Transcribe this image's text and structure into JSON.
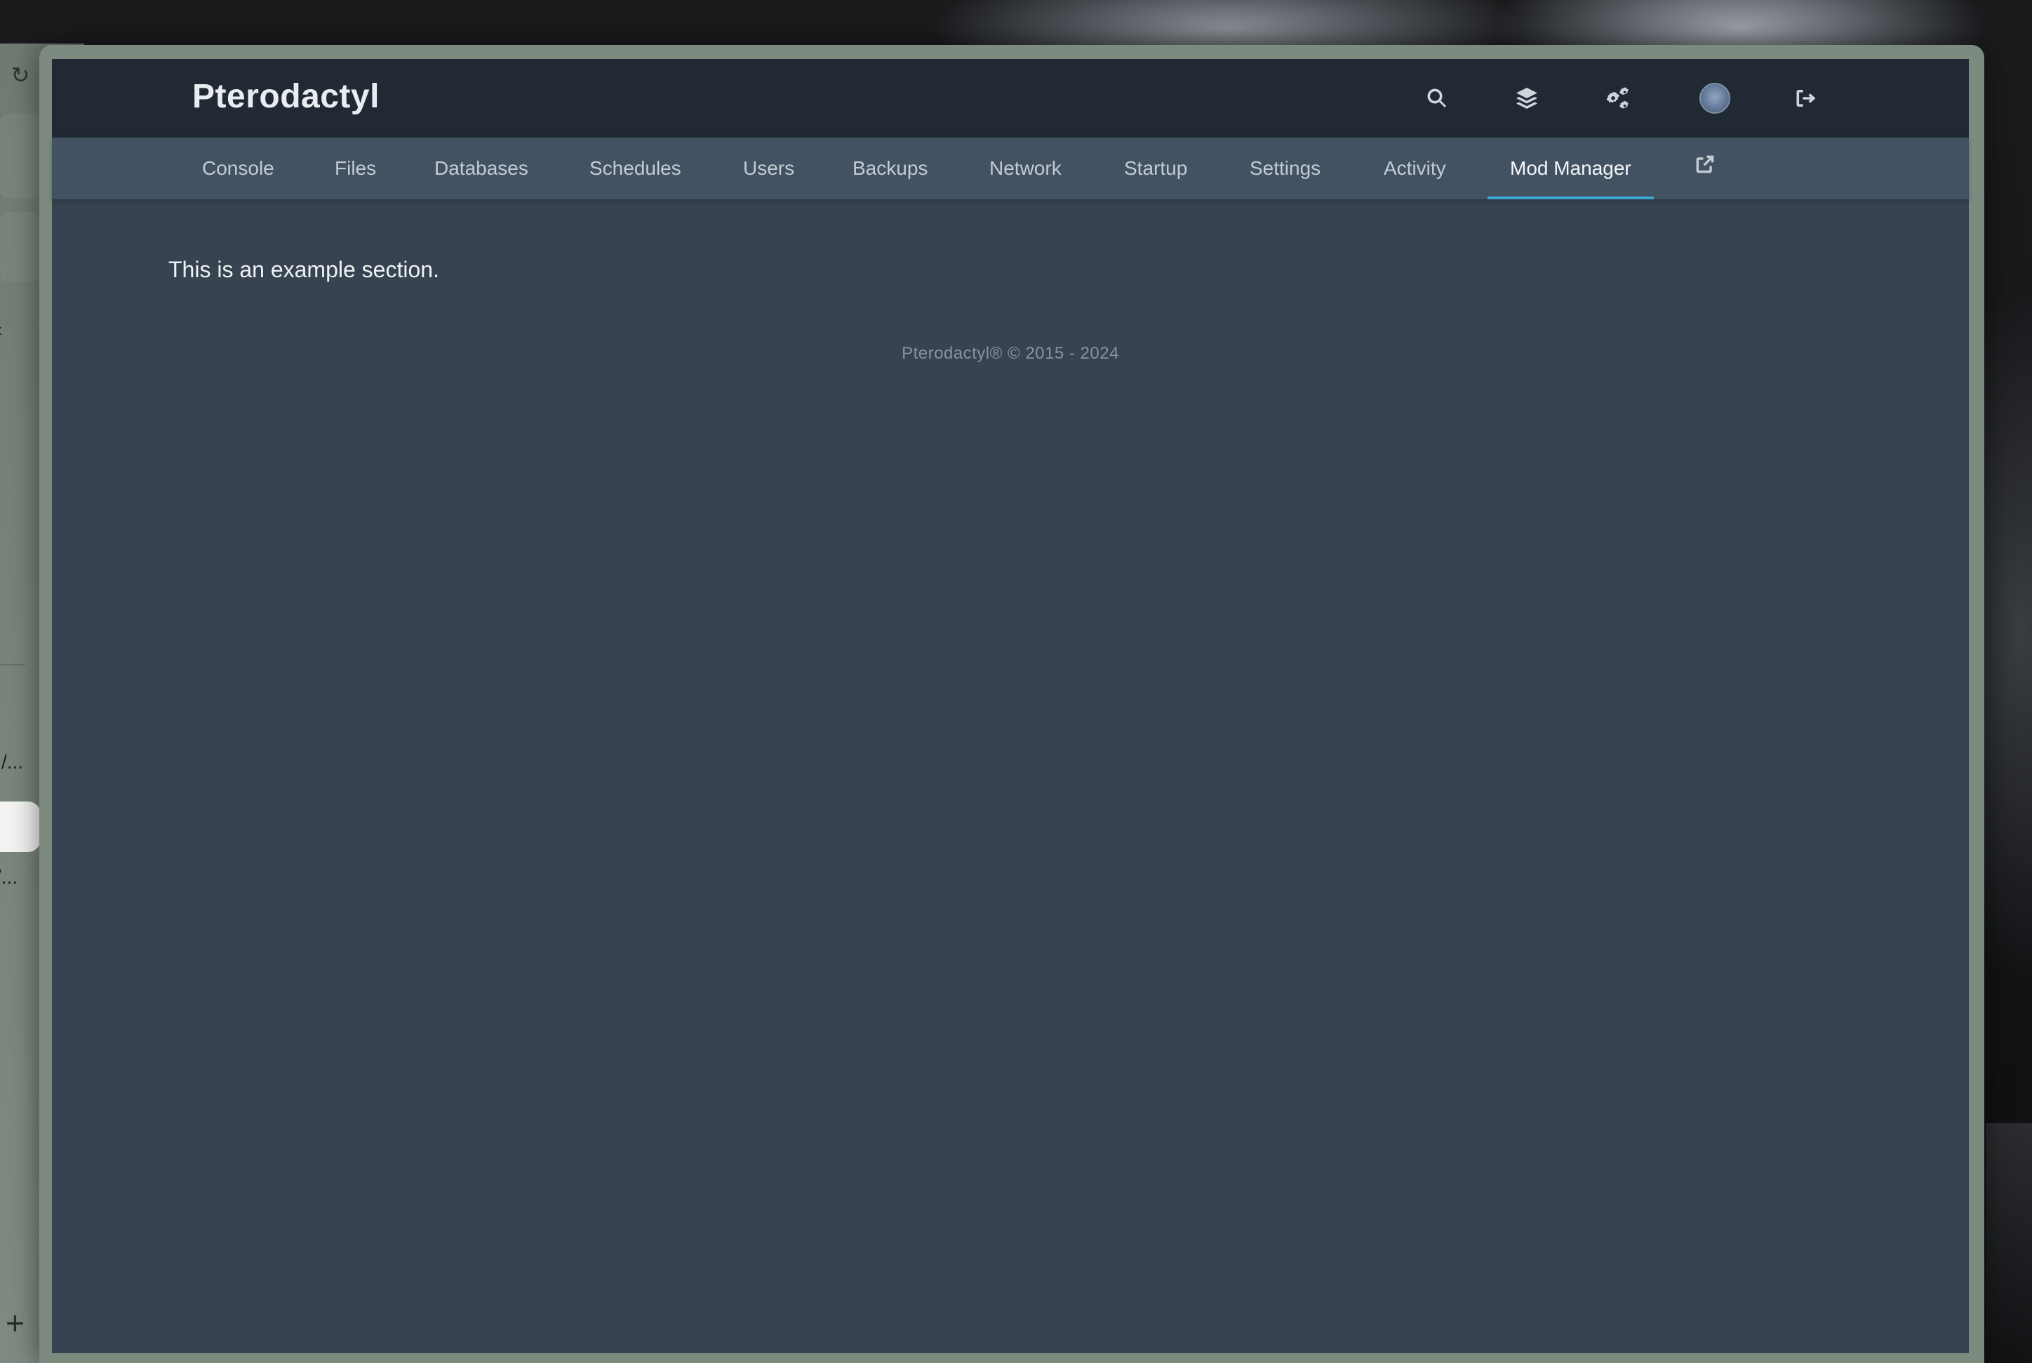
{
  "app": {
    "brand": "Pterodactyl",
    "header_icons": [
      "search-icon",
      "layers-icon",
      "cogs-icon",
      "avatar",
      "sign-out-icon"
    ]
  },
  "tabs": [
    {
      "label": "Console",
      "active": false
    },
    {
      "label": "Files",
      "active": false
    },
    {
      "label": "Databases",
      "active": false
    },
    {
      "label": "Schedules",
      "active": false
    },
    {
      "label": "Users",
      "active": false
    },
    {
      "label": "Backups",
      "active": false
    },
    {
      "label": "Network",
      "active": false
    },
    {
      "label": "Startup",
      "active": false
    },
    {
      "label": "Settings",
      "active": false
    },
    {
      "label": "Activity",
      "active": false
    },
    {
      "label": "Mod Manager",
      "active": true
    }
  ],
  "content": {
    "section_text": "This is an example section.",
    "footer": "Pterodactyl® © 2015 - 2024"
  },
  "background_app": {
    "fragments": [
      "/...",
      "/..."
    ]
  },
  "colors": {
    "topbar": "#212a34",
    "subnav": "#435262",
    "panel": "#374350",
    "accent": "#3fa7d6"
  }
}
